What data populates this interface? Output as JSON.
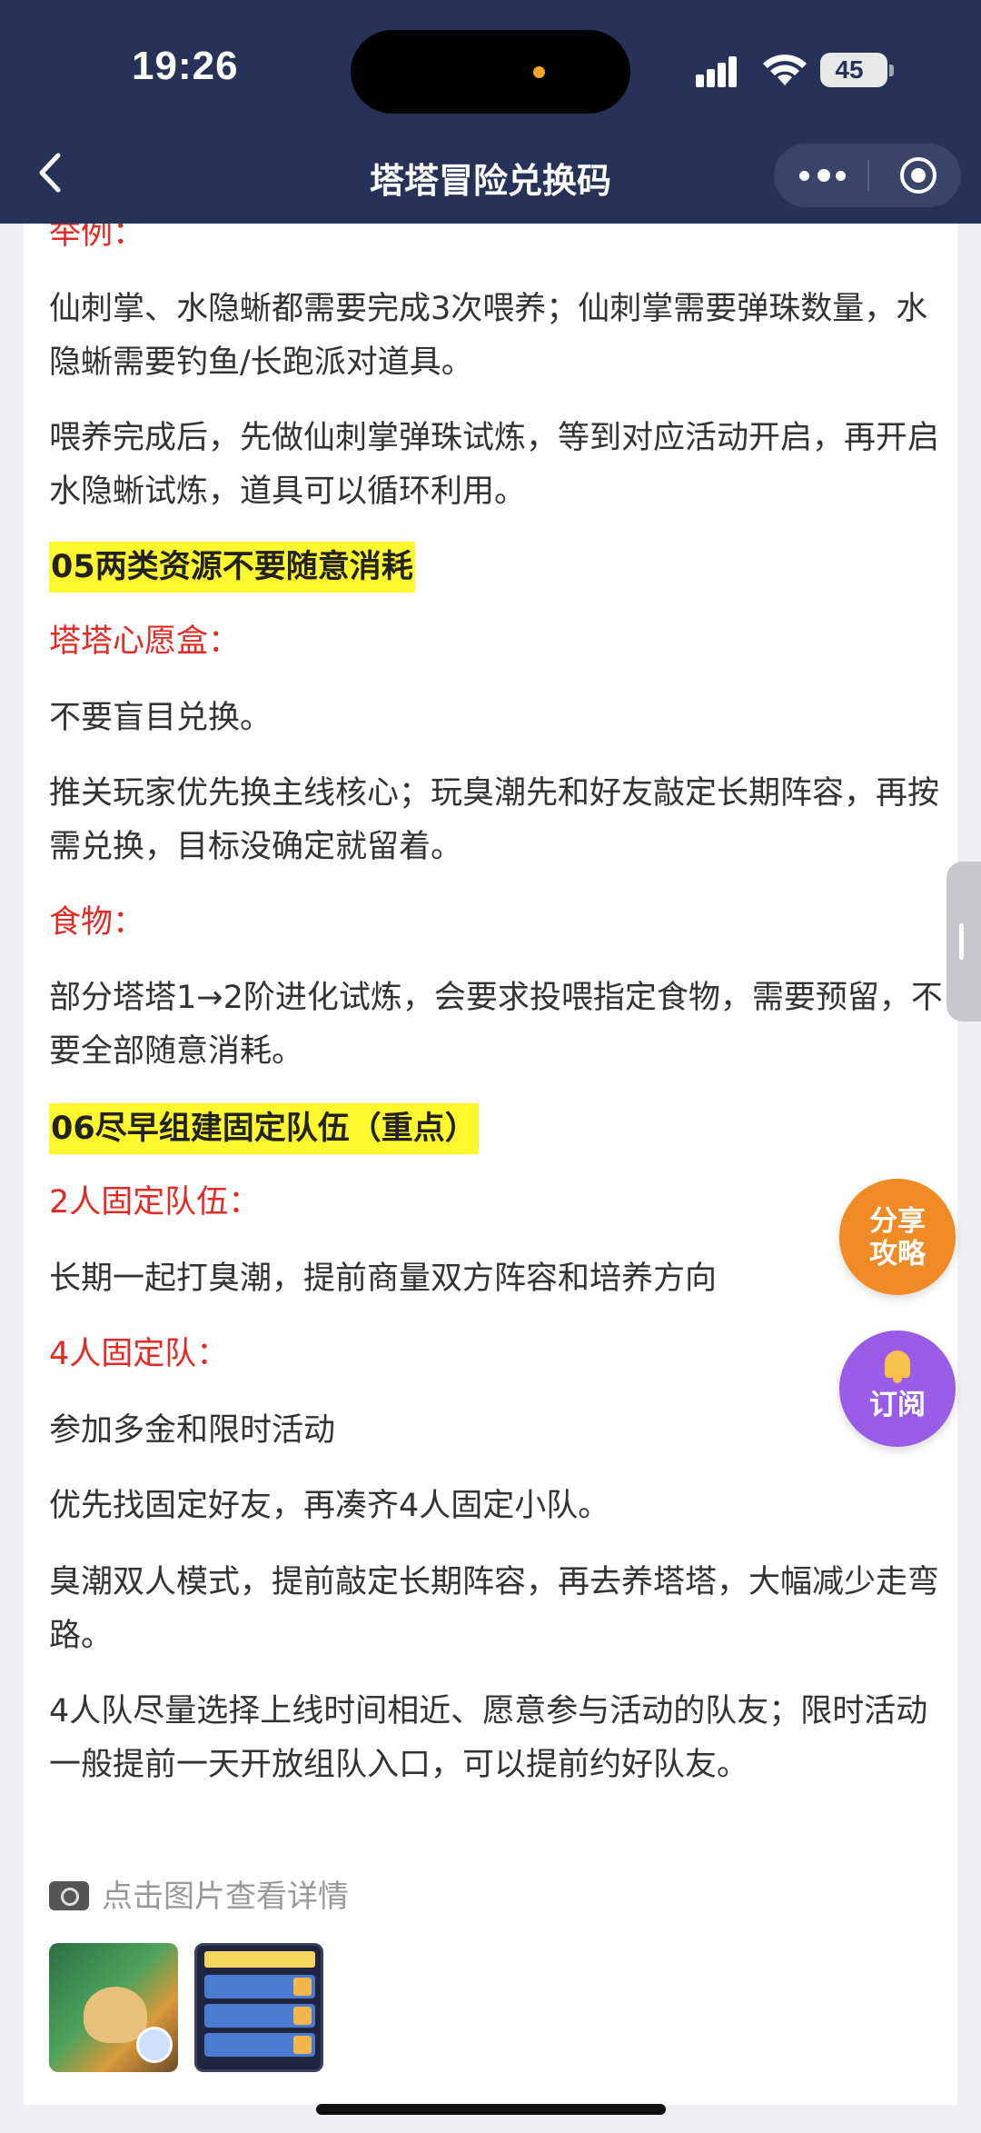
{
  "status_bar": {
    "time": "19:26",
    "battery": "45"
  },
  "nav": {
    "title": "塔塔冒险兑换码"
  },
  "content": {
    "partial_heading": "举例：",
    "p1": "仙刺掌、水隐蜥都需要完成3次喂养；仙刺掌需要弹珠数量，水隐蜥需要钓鱼/长跑派对道具。",
    "p2": "喂养完成后，先做仙刺掌弹珠试炼，等到对应活动开启，再开启水隐蜥试炼，道具可以循环利用。",
    "h05": "05两类资源不要随意消耗",
    "sub_wishbox": "塔塔心愿盒：",
    "p3": "不要盲目兑换。",
    "p4": "推关玩家优先换主线核心；玩臭潮先和好友敲定长期阵容，再按需兑换，目标没确定就留着。",
    "sub_food": "食物：",
    "p5": "部分塔塔1→2阶进化试炼，会要求投喂指定食物，需要预留，不要全部随意消耗。",
    "h06": "06尽早组建固定队伍（重点）",
    "sub_team2": "2人固定队伍：",
    "p6": "长期一起打臭潮，提前商量双方阵容和培养方向",
    "sub_team4": "4人固定队：",
    "p7": "参加多金和限时活动",
    "p8": "优先找固定好友，再凑齐4人固定小队。",
    "p9": "臭潮双人模式，提前敲定长期阵容，再去养塔塔，大幅减少走弯路。",
    "p10": "4人队尽量选择上线时间相近、愿意参与活动的队友；限时活动一般提前一天开放组队入口，可以提前约好队友。",
    "photo_tip": "点击图片查看详情"
  },
  "fab": {
    "share": "分享攻略",
    "subscribe": "订阅"
  }
}
